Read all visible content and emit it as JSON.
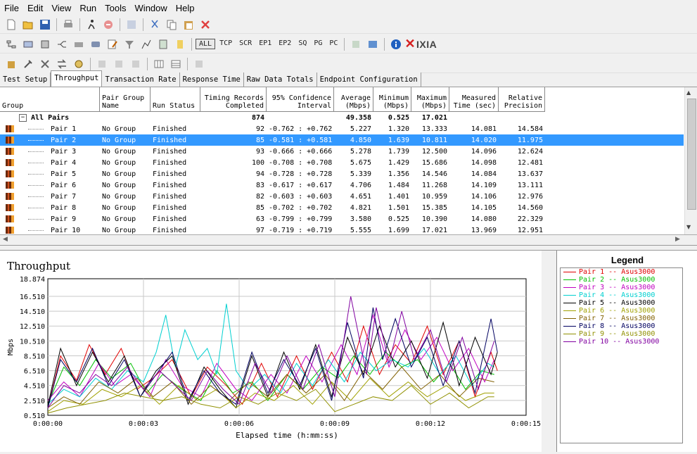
{
  "menu": [
    "File",
    "Edit",
    "View",
    "Run",
    "Tools",
    "Window",
    "Help"
  ],
  "toolbar": {
    "protocols": [
      "ALL",
      "TCP",
      "SCR",
      "EP1",
      "EP2",
      "SQ",
      "PG",
      "PC"
    ],
    "brand": "IXIA"
  },
  "tabs": [
    "Test Setup",
    "Throughput",
    "Transaction Rate",
    "Response Time",
    "Raw Data Totals",
    "Endpoint Configuration"
  ],
  "table": {
    "headers": [
      "Group",
      "Pair Group Name",
      "Run Status",
      "Timing Records Completed",
      "95% Confidence Interval",
      "Average (Mbps)",
      "Minimum (Mbps)",
      "Maximum (Mbps)",
      "Measured Time (sec)",
      "Relative Precision"
    ],
    "summary": {
      "label": "All Pairs",
      "records": "874",
      "average": "49.358",
      "minimum": "0.525",
      "maximum": "17.021"
    },
    "rows": [
      {
        "pair": "Pair 1",
        "group": "No Group",
        "status": "Finished",
        "records": "92",
        "ci": "-0.762 : +0.762",
        "avg": "5.227",
        "min": "1.320",
        "max": "13.333",
        "time": "14.081",
        "prec": "14.584"
      },
      {
        "pair": "Pair 2",
        "group": "No Group",
        "status": "Finished",
        "records": "85",
        "ci": "-0.581 : +0.581",
        "avg": "4.850",
        "min": "1.639",
        "max": "10.811",
        "time": "14.020",
        "prec": "11.975"
      },
      {
        "pair": "Pair 3",
        "group": "No Group",
        "status": "Finished",
        "records": "93",
        "ci": "-0.666 : +0.666",
        "avg": "5.278",
        "min": "1.739",
        "max": "12.500",
        "time": "14.096",
        "prec": "12.624"
      },
      {
        "pair": "Pair 4",
        "group": "No Group",
        "status": "Finished",
        "records": "100",
        "ci": "-0.708 : +0.708",
        "avg": "5.675",
        "min": "1.429",
        "max": "15.686",
        "time": "14.098",
        "prec": "12.481"
      },
      {
        "pair": "Pair 5",
        "group": "No Group",
        "status": "Finished",
        "records": "94",
        "ci": "-0.728 : +0.728",
        "avg": "5.339",
        "min": "1.356",
        "max": "14.546",
        "time": "14.084",
        "prec": "13.637"
      },
      {
        "pair": "Pair 6",
        "group": "No Group",
        "status": "Finished",
        "records": "83",
        "ci": "-0.617 : +0.617",
        "avg": "4.706",
        "min": "1.484",
        "max": "11.268",
        "time": "14.109",
        "prec": "13.111"
      },
      {
        "pair": "Pair 7",
        "group": "No Group",
        "status": "Finished",
        "records": "82",
        "ci": "-0.603 : +0.603",
        "avg": "4.651",
        "min": "1.401",
        "max": "10.959",
        "time": "14.106",
        "prec": "12.976"
      },
      {
        "pair": "Pair 8",
        "group": "No Group",
        "status": "Finished",
        "records": "85",
        "ci": "-0.702 : +0.702",
        "avg": "4.821",
        "min": "1.501",
        "max": "15.385",
        "time": "14.105",
        "prec": "14.560"
      },
      {
        "pair": "Pair 9",
        "group": "No Group",
        "status": "Finished",
        "records": "63",
        "ci": "-0.799 : +0.799",
        "avg": "3.580",
        "min": "0.525",
        "max": "10.390",
        "time": "14.080",
        "prec": "22.329"
      },
      {
        "pair": "Pair 10",
        "group": "No Group",
        "status": "Finished",
        "records": "97",
        "ci": "-0.719 : +0.719",
        "avg": "5.555",
        "min": "1.699",
        "max": "17.021",
        "time": "13.969",
        "prec": "12.951"
      }
    ],
    "selected_row": 1
  },
  "chart_data": {
    "type": "line",
    "title": "Throughput",
    "xlabel": "Elapsed time (h:mm:ss)",
    "ylabel": "Mbps",
    "yticks": [
      "0.510",
      "2.510",
      "4.510",
      "6.510",
      "8.510",
      "10.510",
      "12.510",
      "14.510",
      "16.510",
      "18.874"
    ],
    "ylim": [
      0.51,
      18.874
    ],
    "xticks": [
      "0:00:00",
      "0:00:03",
      "0:00:06",
      "0:00:09",
      "0:00:12",
      "0:00:15"
    ],
    "xlim": [
      0,
      15
    ],
    "grid": true,
    "series": [
      {
        "name": "Pair 1 -- Asus3000",
        "color": "#e00000",
        "x": [
          0,
          0.4,
          0.9,
          1.3,
          1.8,
          2.3,
          2.8,
          3.3,
          3.9,
          4.5,
          5.0,
          5.6,
          6.1,
          6.7,
          7.2,
          7.8,
          8.3,
          8.9,
          9.4,
          9.9,
          10.4,
          10.9,
          11.4,
          11.9,
          12.4,
          12.9,
          13.4,
          13.9,
          14.1
        ],
        "y": [
          1.5,
          8.5,
          5.2,
          10.0,
          6.0,
          9.5,
          4.0,
          5.5,
          8.0,
          3.0,
          7.0,
          4.5,
          2.0,
          7.5,
          3.0,
          8.5,
          4.0,
          9.0,
          5.0,
          12.5,
          6.0,
          10.0,
          7.5,
          12.5,
          6.0,
          10.5,
          3.0,
          9.0,
          6.5
        ]
      },
      {
        "name": "Pair 2 -- Asus3000",
        "color": "#00c000",
        "x": [
          0,
          0.5,
          1.0,
          1.5,
          2.0,
          2.6,
          3.1,
          3.6,
          4.2,
          4.8,
          5.3,
          5.8,
          6.4,
          6.9,
          7.5,
          8.0,
          8.6,
          9.1,
          9.6,
          10.1,
          10.6,
          11.1,
          11.6,
          12.1,
          12.6,
          13.1,
          13.6,
          14.0
        ],
        "y": [
          2.0,
          7.0,
          4.5,
          8.0,
          5.5,
          7.5,
          3.5,
          6.0,
          4.0,
          2.5,
          6.5,
          3.5,
          5.0,
          2.5,
          6.0,
          4.0,
          7.0,
          5.5,
          8.5,
          6.0,
          9.0,
          7.0,
          8.0,
          5.0,
          7.5,
          4.0,
          6.5,
          6.0
        ]
      },
      {
        "name": "Pair 3 -- Asus3000",
        "color": "#c000c0",
        "x": [
          0,
          0.5,
          1.0,
          1.6,
          2.1,
          2.6,
          3.2,
          3.7,
          4.2,
          4.8,
          5.3,
          5.9,
          6.4,
          7.0,
          7.5,
          8.1,
          8.6,
          9.2,
          9.7,
          10.2,
          10.7,
          11.2,
          11.7,
          12.2,
          12.7,
          13.2,
          13.7,
          14.0
        ],
        "y": [
          2.5,
          5.0,
          3.0,
          7.5,
          4.5,
          6.0,
          3.0,
          8.0,
          4.5,
          3.0,
          7.5,
          4.0,
          2.5,
          6.0,
          3.5,
          8.5,
          5.0,
          10.0,
          6.0,
          14.0,
          7.0,
          12.0,
          8.0,
          11.0,
          6.5,
          9.5,
          5.0,
          8.0
        ]
      },
      {
        "name": "Pair 4 -- Asus3000",
        "color": "#00d0d0",
        "x": [
          0,
          0.5,
          1.0,
          1.5,
          2.0,
          2.5,
          3.0,
          3.4,
          3.7,
          4.0,
          4.3,
          4.7,
          5.0,
          5.3,
          5.6,
          5.9,
          6.3,
          6.8,
          7.3,
          7.8,
          8.3,
          8.8,
          9.3,
          9.8,
          10.3,
          10.8,
          11.3,
          11.8,
          12.3,
          12.8,
          13.3,
          13.8,
          14.0
        ],
        "y": [
          2.0,
          4.0,
          3.0,
          5.5,
          4.0,
          6.5,
          5.0,
          9.0,
          14.0,
          7.0,
          12.0,
          8.0,
          9.5,
          6.0,
          15.5,
          6.5,
          4.0,
          6.0,
          3.5,
          7.5,
          4.5,
          8.0,
          5.0,
          9.0,
          6.5,
          8.0,
          7.0,
          9.5,
          6.0,
          8.5,
          4.5,
          7.5,
          7.0
        ]
      },
      {
        "name": "Pair 5 -- Asus3000",
        "color": "#000000",
        "x": [
          0,
          0.4,
          0.9,
          1.4,
          1.9,
          2.4,
          2.9,
          3.4,
          3.9,
          4.4,
          4.9,
          5.4,
          5.9,
          6.4,
          6.9,
          7.4,
          7.9,
          8.4,
          8.9,
          9.4,
          9.9,
          10.4,
          10.9,
          11.4,
          11.9,
          12.4,
          12.9,
          13.4,
          13.9,
          14.1
        ],
        "y": [
          1.8,
          9.5,
          4.5,
          9.0,
          5.0,
          8.5,
          3.0,
          6.5,
          8.5,
          2.0,
          7.0,
          4.0,
          1.5,
          8.5,
          3.0,
          9.0,
          4.0,
          10.0,
          3.0,
          11.0,
          6.0,
          12.5,
          7.0,
          10.5,
          5.5,
          13.0,
          4.5,
          11.0,
          6.0,
          9.0
        ]
      },
      {
        "name": "Pair 6 -- Asus3000",
        "color": "#a0a000",
        "x": [
          0,
          0.5,
          1.1,
          1.7,
          2.3,
          2.9,
          3.5,
          4.1,
          4.7,
          5.3,
          5.9,
          6.5,
          7.1,
          7.7,
          8.3,
          8.9,
          9.5,
          10.1,
          10.7,
          11.3,
          11.9,
          12.5,
          13.1,
          13.7,
          14.0
        ],
        "y": [
          1.0,
          2.5,
          2.0,
          4.0,
          3.0,
          4.5,
          2.0,
          4.5,
          2.5,
          4.0,
          1.5,
          3.5,
          2.5,
          4.5,
          2.0,
          5.0,
          2.5,
          5.5,
          3.0,
          5.0,
          3.0,
          4.5,
          2.5,
          3.5,
          3.5
        ]
      },
      {
        "name": "Pair 7 -- Asus3000",
        "color": "#806000",
        "x": [
          0,
          0.5,
          1.0,
          1.6,
          2.2,
          2.8,
          3.3,
          3.9,
          4.5,
          5.1,
          5.7,
          6.3,
          6.9,
          7.5,
          8.1,
          8.7,
          9.3,
          9.9,
          10.5,
          11.1,
          11.7,
          12.3,
          12.9,
          13.5,
          14.0
        ],
        "y": [
          1.5,
          3.0,
          2.0,
          5.0,
          3.5,
          5.5,
          3.0,
          5.0,
          2.0,
          4.5,
          2.5,
          5.0,
          3.0,
          6.0,
          3.5,
          6.0,
          2.5,
          6.5,
          4.0,
          7.0,
          4.0,
          6.0,
          3.0,
          5.5,
          5.0
        ]
      },
      {
        "name": "Pair 8 -- Asus3000",
        "color": "#000060",
        "x": [
          0,
          0.4,
          0.9,
          1.4,
          1.9,
          2.4,
          2.9,
          3.4,
          3.9,
          4.4,
          4.9,
          5.4,
          5.9,
          6.4,
          6.9,
          7.4,
          7.9,
          8.4,
          8.9,
          9.4,
          9.9,
          10.2,
          10.5,
          10.9,
          11.4,
          11.9,
          12.4,
          12.9,
          13.4,
          13.9,
          14.1
        ],
        "y": [
          1.5,
          8.0,
          5.0,
          9.5,
          4.5,
          8.0,
          3.0,
          6.0,
          9.0,
          2.5,
          6.5,
          3.5,
          2.0,
          9.0,
          3.5,
          8.0,
          4.5,
          9.5,
          2.5,
          13.0,
          5.5,
          15.0,
          8.0,
          13.5,
          7.0,
          11.0,
          4.5,
          10.5,
          3.5,
          13.5,
          9.0
        ]
      },
      {
        "name": "Pair 9 -- Asus3000",
        "color": "#909000",
        "x": [
          0,
          0.6,
          1.2,
          1.8,
          2.4,
          3.0,
          3.6,
          4.2,
          4.8,
          5.4,
          6.0,
          6.6,
          7.2,
          7.8,
          8.4,
          9.0,
          9.6,
          10.2,
          10.8,
          11.4,
          12.0,
          12.6,
          13.2,
          13.8,
          14.0
        ],
        "y": [
          0.8,
          1.5,
          2.0,
          2.5,
          3.5,
          3.0,
          2.5,
          3.0,
          2.0,
          1.5,
          3.0,
          2.0,
          3.5,
          2.5,
          4.0,
          1.0,
          2.0,
          3.0,
          2.5,
          4.5,
          2.0,
          3.5,
          1.5,
          3.0,
          3.0
        ]
      },
      {
        "name": "Pair 10 -- Asus3000",
        "color": "#8000a0",
        "x": [
          0,
          0.5,
          1.0,
          1.5,
          2.0,
          2.5,
          3.0,
          3.5,
          4.0,
          4.5,
          5.0,
          5.5,
          6.0,
          6.5,
          7.0,
          7.5,
          8.0,
          8.5,
          9.0,
          9.5,
          10.0,
          10.3,
          10.7,
          11.1,
          11.5,
          12.0,
          12.5,
          13.0,
          13.5,
          14.0
        ],
        "y": [
          1.5,
          4.5,
          3.5,
          6.0,
          4.5,
          7.0,
          4.0,
          6.5,
          4.5,
          2.5,
          6.5,
          4.0,
          2.0,
          7.5,
          3.5,
          8.5,
          4.0,
          10.0,
          3.0,
          16.5,
          6.0,
          15.0,
          7.5,
          14.5,
          8.0,
          12.0,
          5.0,
          11.0,
          4.0,
          10.5
        ]
      }
    ]
  }
}
